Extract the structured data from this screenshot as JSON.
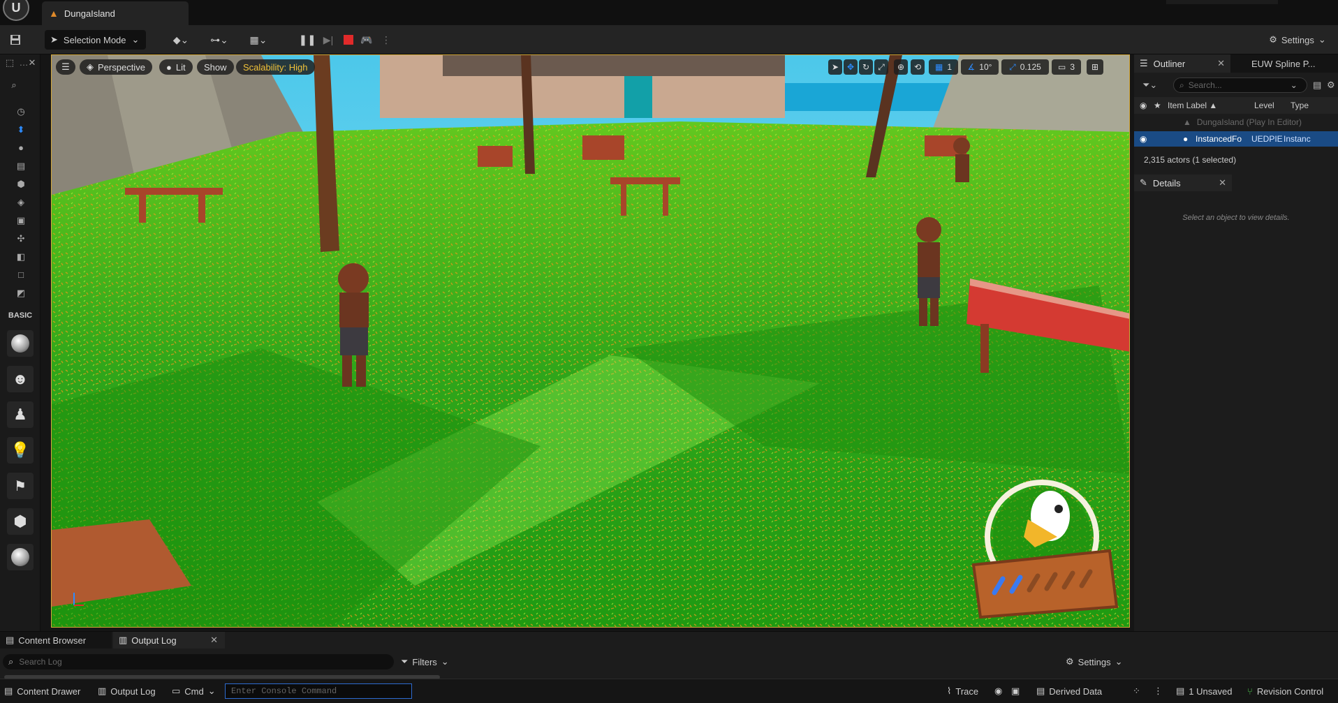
{
  "window": {
    "level_tab": "DungaIsland"
  },
  "toolbar": {
    "selection_mode": "Selection Mode",
    "settings": "Settings"
  },
  "left_panel": {
    "basic_label": "BASIC"
  },
  "viewport": {
    "perspective": "Perspective",
    "lit": "Lit",
    "show": "Show",
    "scalability": "Scalability: High",
    "grid_value": "1",
    "angle_value": "10°",
    "scale_value": "0.125",
    "camera_speed": "3"
  },
  "outliner": {
    "tab_label": "Outliner",
    "spline_tab": "EUW Spline P...",
    "search_placeholder": "Search...",
    "col_item_label": "Item Label",
    "col_level": "Level",
    "col_type": "Type",
    "row1_label": "DungaIsland (Play In Editor)",
    "row2_label": "InstancedFo",
    "row2_level": "UEDPIE",
    "row2_type": "Instanc",
    "actor_count": "2,315 actors (1 selected)"
  },
  "details": {
    "tab_label": "Details",
    "hint": "Select an object to view details."
  },
  "bottom": {
    "content_browser": "Content Browser",
    "output_log": "Output Log",
    "search_log_placeholder": "Search Log",
    "filters": "Filters",
    "settings": "Settings"
  },
  "statusbar": {
    "content_drawer": "Content Drawer",
    "output_log": "Output Log",
    "cmd": "Cmd",
    "console_placeholder": "Enter Console Command",
    "trace": "Trace",
    "derived_data": "Derived Data",
    "unsaved": "1 Unsaved",
    "revision_control": "Revision Control"
  },
  "colors": {
    "accent": "#2d8cff",
    "stop": "#e02a2a",
    "warning": "#f0c23a",
    "selection": "#1a4b85"
  }
}
